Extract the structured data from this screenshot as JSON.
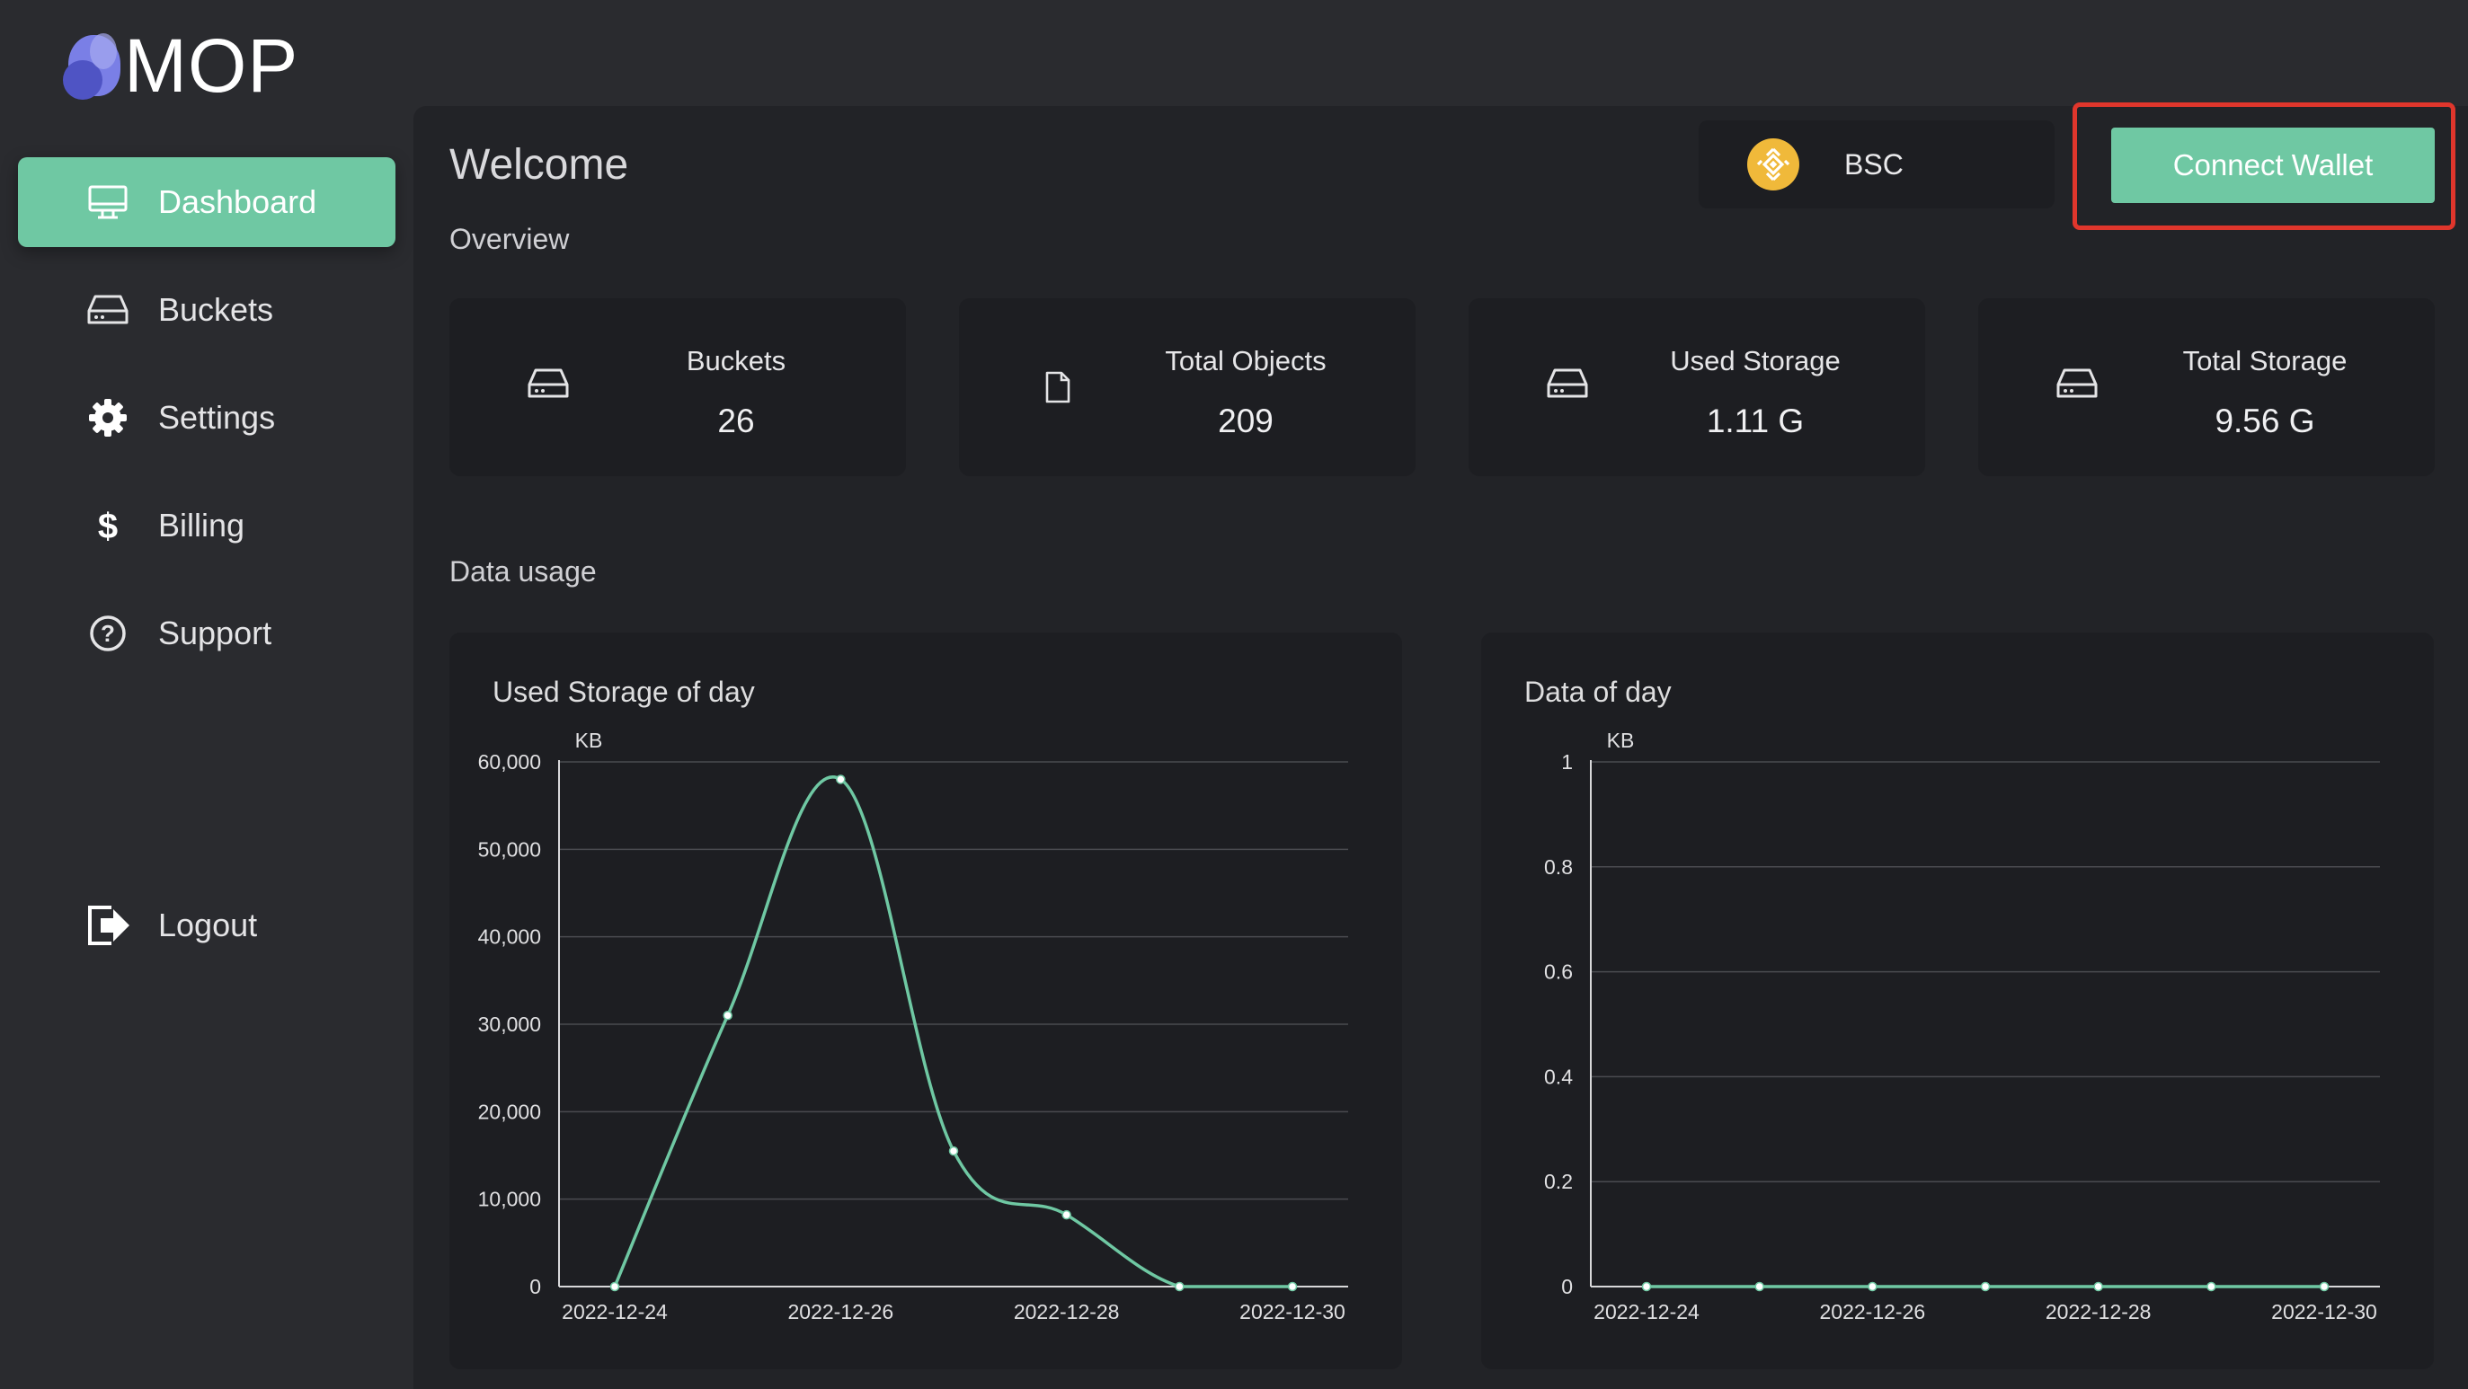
{
  "app": {
    "name": "MOP"
  },
  "sidebar": {
    "items": [
      {
        "label": "Dashboard",
        "icon": "monitor-icon",
        "active": true
      },
      {
        "label": "Buckets",
        "icon": "drive-icon"
      },
      {
        "label": "Settings",
        "icon": "gear-icon"
      },
      {
        "label": "Billing",
        "icon": "dollar-icon"
      },
      {
        "label": "Support",
        "icon": "question-circle-icon"
      }
    ],
    "logout_label": "Logout"
  },
  "header": {
    "title": "Welcome",
    "network": {
      "label": "BSC",
      "icon": "bnb-coin-icon",
      "color": "#f0b93a"
    },
    "connect_label": "Connect Wallet"
  },
  "overview": {
    "heading": "Overview",
    "stats": [
      {
        "title": "Buckets",
        "value": "26",
        "icon": "drive-icon"
      },
      {
        "title": "Total Objects",
        "value": "209",
        "icon": "file-icon"
      },
      {
        "title": "Used Storage",
        "value": "1.11 G",
        "icon": "drive-icon"
      },
      {
        "title": "Total Storage",
        "value": "9.56 G",
        "icon": "drive-icon"
      }
    ]
  },
  "data_usage": {
    "heading": "Data usage"
  },
  "colors": {
    "accent": "#6fc8a3",
    "highlight": "#e0362c",
    "background": "#2a2b2f",
    "panel": "#222327",
    "card": "#1d1e22"
  },
  "chart_data": [
    {
      "type": "line",
      "title": "Used Storage of day",
      "ylabel": "KB",
      "x": [
        "2022-12-24",
        "2022-12-25",
        "2022-12-26",
        "2022-12-27",
        "2022-12-28",
        "2022-12-29",
        "2022-12-30"
      ],
      "x_tick_labels": [
        "2022-12-24",
        "2022-12-26",
        "2022-12-28",
        "2022-12-30"
      ],
      "series": [
        {
          "values": [
            0,
            31000,
            58000,
            15500,
            8200,
            0,
            0
          ]
        }
      ],
      "ylim": [
        0,
        60000
      ],
      "y_ticks": [
        "0",
        "10,000",
        "20,000",
        "30,000",
        "40,000",
        "50,000",
        "60,000"
      ],
      "grid": true,
      "smooth": true
    },
    {
      "type": "line",
      "title": "Data of day",
      "ylabel": "KB",
      "x": [
        "2022-12-24",
        "2022-12-25",
        "2022-12-26",
        "2022-12-27",
        "2022-12-28",
        "2022-12-29",
        "2022-12-30"
      ],
      "x_tick_labels": [
        "2022-12-24",
        "2022-12-26",
        "2022-12-28",
        "2022-12-30"
      ],
      "series": [
        {
          "values": [
            0,
            0,
            0,
            0,
            0,
            0,
            0
          ]
        }
      ],
      "ylim": [
        0,
        1
      ],
      "y_ticks": [
        "0",
        "0.2",
        "0.4",
        "0.6",
        "0.8",
        "1"
      ],
      "grid": true,
      "smooth": true
    }
  ]
}
